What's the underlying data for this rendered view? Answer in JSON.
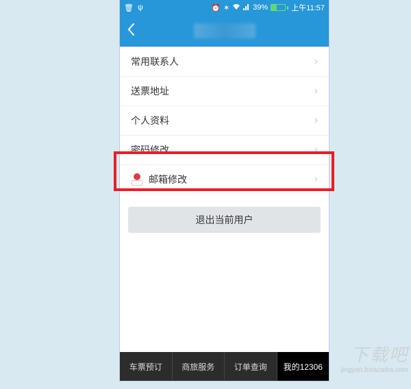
{
  "status": {
    "battery_pct": "39%",
    "time": "上午11:57"
  },
  "menu": {
    "items": [
      {
        "label": "常用联系人"
      },
      {
        "label": "送票地址"
      },
      {
        "label": "个人资料"
      },
      {
        "label": "密码修改"
      },
      {
        "label": "邮箱修改"
      }
    ]
  },
  "logout_label": "退出当前用户",
  "bottom_nav": {
    "items": [
      {
        "label": "车票预订"
      },
      {
        "label": "商旅服务"
      },
      {
        "label": "订单查询"
      },
      {
        "label": "我的12306"
      }
    ]
  },
  "watermark": {
    "main": "下载吧",
    "sub": "jingyan.bxiazaiba.com"
  }
}
